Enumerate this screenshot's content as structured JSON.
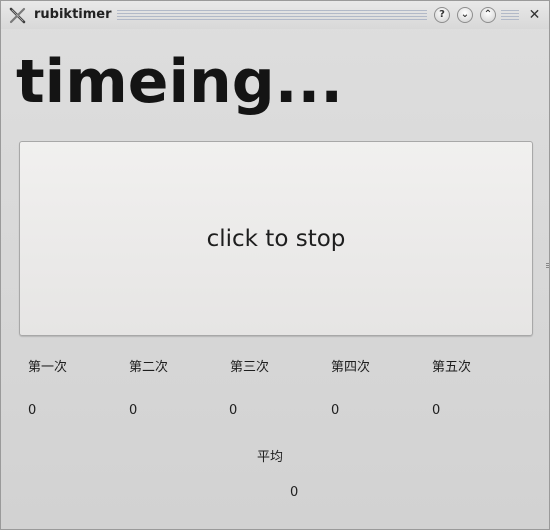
{
  "window": {
    "title": "rubiktimer",
    "icon": "rubik-x-icon",
    "buttons": {
      "help": "?",
      "minimize": "⌄",
      "maximize": "⌃",
      "close": "✕"
    }
  },
  "main": {
    "status_text": "timeing...",
    "stop_button_label": "click to stop"
  },
  "trials": [
    {
      "label": "第一次",
      "value": "0"
    },
    {
      "label": "第二次",
      "value": "0"
    },
    {
      "label": "第三次",
      "value": "0"
    },
    {
      "label": "第四次",
      "value": "0"
    },
    {
      "label": "第五次",
      "value": "0"
    }
  ],
  "average": {
    "label": "平均",
    "value": "0"
  }
}
